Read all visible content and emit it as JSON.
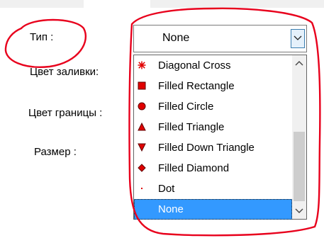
{
  "labels": {
    "type": "Тип :",
    "fill_color": "Цвет заливки:",
    "border_color": "Цвет границы :",
    "size": "Размер :"
  },
  "combo": {
    "value": "None",
    "dropdown_icon": "chevron-down-icon"
  },
  "options": [
    {
      "label": "Diagonal Cross",
      "icon": "asterisk-icon"
    },
    {
      "label": "Filled Rectangle",
      "icon": "filled-square-icon"
    },
    {
      "label": "Filled Circle",
      "icon": "filled-circle-icon"
    },
    {
      "label": "Filled Triangle",
      "icon": "filled-triangle-icon"
    },
    {
      "label": "Filled Down Triangle",
      "icon": "filled-down-triangle-icon"
    },
    {
      "label": "Filled Diamond",
      "icon": "filled-diamond-icon"
    },
    {
      "label": "Dot",
      "icon": "dot-icon"
    },
    {
      "label": "None",
      "icon": ""
    }
  ],
  "selected_option": "None",
  "colors": {
    "marker_red": "#e00000",
    "highlight": "#3399ff",
    "annotation": "#e8001c"
  }
}
